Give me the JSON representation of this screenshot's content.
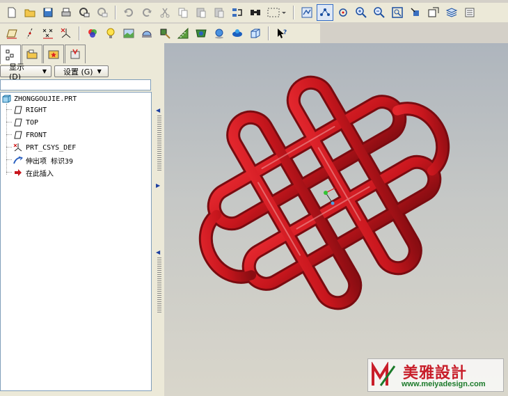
{
  "toolbar_primary": {
    "items": [
      "new-file-icon",
      "open-folder-icon",
      "save-icon",
      "print-icon",
      "send-mail-icon",
      "mail-attach-icon",
      "undo-icon",
      "redo-icon",
      "cut-icon",
      "copy-icon",
      "paste-icon",
      "paste-special-icon",
      "regenerate-icon",
      "find-icon",
      "selection-box-icon",
      "repaint-icon",
      "spin-center-icon",
      "orient-icon",
      "zoom-in-icon",
      "zoom-out-icon",
      "refit-icon",
      "reorient-icon",
      "saved-views-icon",
      "layers-icon",
      "model-display-icon"
    ]
  },
  "toolbar_secondary": {
    "items": [
      "datum-planes-icon",
      "datum-axes-icon",
      "datum-points-icon",
      "coordinate-systems-icon",
      "appearance-icon",
      "light-icon",
      "environment-icon",
      "render-icon",
      "analysis-icon",
      "curve-analysis-icon",
      "shade-icon",
      "model-sphere-icon",
      "color-icon",
      "box-view-icon",
      "context-help-icon"
    ]
  },
  "panel": {
    "tabs": [
      "model-tree-tab",
      "folder-browser-tab",
      "favorites-tab",
      "connections-tab"
    ],
    "display_menu": "显示 (D)",
    "settings_menu": "设置 (G)"
  },
  "tree": {
    "root": "ZHONGGOUJIE.PRT",
    "nodes": [
      {
        "label": "RIGHT",
        "icon": "datum-plane-icon"
      },
      {
        "label": "TOP",
        "icon": "datum-plane-icon"
      },
      {
        "label": "FRONT",
        "icon": "datum-plane-icon"
      },
      {
        "label": "PRT_CSYS_DEF",
        "icon": "csys-icon"
      },
      {
        "label": "伸出项 标识39",
        "icon": "sweep-feature-icon"
      },
      {
        "label": "在此插入",
        "icon": "insert-here-arrow-icon"
      }
    ]
  },
  "colors": {
    "knot_red": "#c8161d",
    "knot_dark": "#8a0d12",
    "tree_selected": "#316ac5"
  },
  "watermark": {
    "title": "美雅設計",
    "url": "www.meiyadesign.com"
  }
}
